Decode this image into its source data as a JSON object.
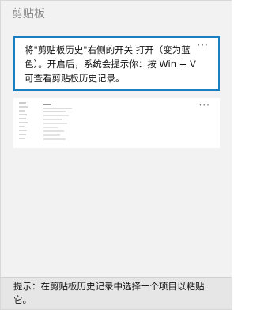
{
  "panel": {
    "title": "剪贴板"
  },
  "items": [
    {
      "text": "将\"剪贴板历史\"右侧的开关 打开（变为蓝色）。开启后，系统会提示你：按 Win + V 可查看剪贴板历史记录。",
      "more_label": "···"
    },
    {
      "more_label": "···"
    }
  ],
  "footer": {
    "tip": "提示：在剪贴板历史记录中选择一个项目以粘贴它。"
  },
  "colors": {
    "selection_border": "#1a7fc0",
    "panel_bg": "#f2f2f2",
    "footer_bg": "#e6e6e6"
  }
}
